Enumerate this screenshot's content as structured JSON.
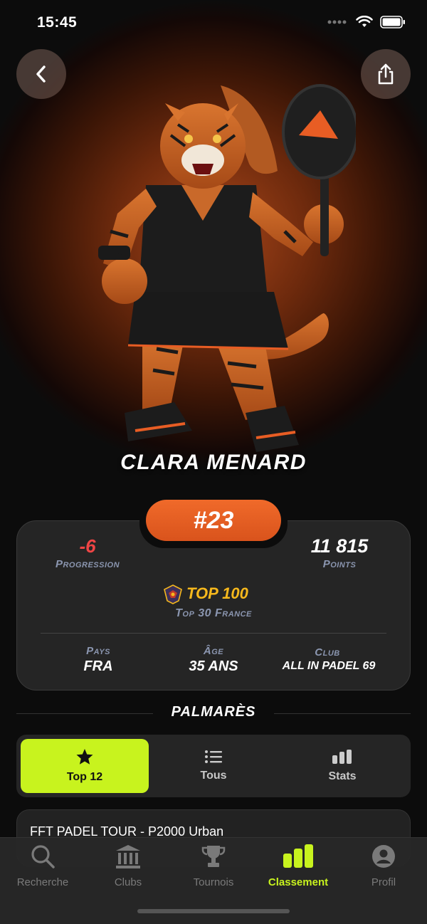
{
  "status_bar": {
    "time": "15:45"
  },
  "player": {
    "name": "CLARA MENARD",
    "rank": "#23",
    "progression_value": "-6",
    "progression_label": "Progression",
    "points_value": "11 815",
    "points_label": "Points",
    "tier_label": "TOP 100",
    "tier_sub": "Top 30 France",
    "country_label": "Pays",
    "country_value": "FRA",
    "age_label": "Âge",
    "age_value": "35 ANS",
    "club_label": "Club",
    "club_value": "ALL IN PADEL 69"
  },
  "palmares": {
    "title": "PALMARÈS",
    "tabs": [
      {
        "label": "Top 12",
        "icon": "star-icon"
      },
      {
        "label": "Tous",
        "icon": "list-icon"
      },
      {
        "label": "Stats",
        "icon": "bars-icon"
      }
    ],
    "events": [
      {
        "title": "FFT PADEL TOUR - P2000 Urban"
      }
    ]
  },
  "nav": {
    "items": [
      {
        "label": "Recherche",
        "icon": "search-icon"
      },
      {
        "label": "Clubs",
        "icon": "building-icon"
      },
      {
        "label": "Tournois",
        "icon": "trophy-icon"
      },
      {
        "label": "Classement",
        "icon": "ranking-icon"
      },
      {
        "label": "Profil",
        "icon": "user-icon"
      }
    ],
    "active": "Classement"
  },
  "colors": {
    "accent": "#c8f31e",
    "rank_pill": "#e85d24",
    "progression": "#f04545",
    "tier": "#f6b81c",
    "muted_label": "#8b96b0"
  }
}
